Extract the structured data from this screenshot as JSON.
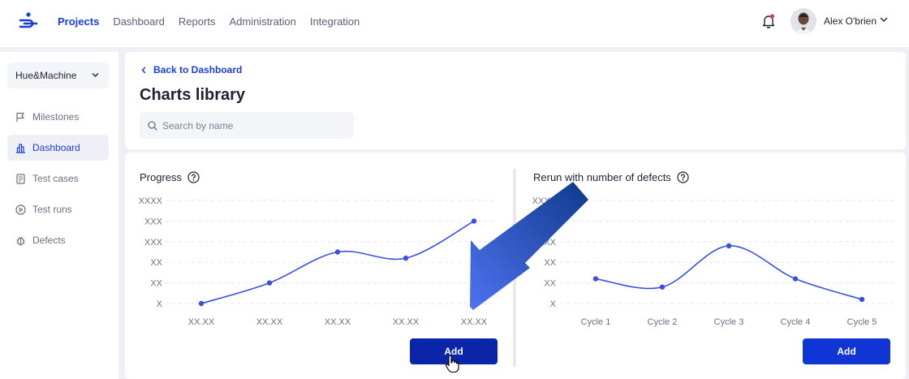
{
  "nav": {
    "items": [
      "Projects",
      "Dashboard",
      "Reports",
      "Administration",
      "Integration"
    ],
    "active_index": 0
  },
  "user": {
    "name": "Alex O'brien"
  },
  "sidebar": {
    "project": "Hue&Machine",
    "items": [
      {
        "label": "Milestones",
        "icon": "flag-icon"
      },
      {
        "label": "Dashboard",
        "icon": "bar-chart-icon",
        "active": true
      },
      {
        "label": "Test cases",
        "icon": "document-icon"
      },
      {
        "label": "Test runs",
        "icon": "play-circle-icon"
      },
      {
        "label": "Defects",
        "icon": "bug-icon"
      }
    ]
  },
  "header": {
    "back_label": "Back to Dashboard",
    "title": "Charts library",
    "search_placeholder": "Search by name"
  },
  "charts": [
    {
      "title": "Progress",
      "add_label": "Add"
    },
    {
      "title": "Rerun with number of defects",
      "add_label": "Add"
    }
  ],
  "chart_data": [
    {
      "type": "line",
      "title": "Progress",
      "categories": [
        "XX.XX",
        "XX.XX",
        "XX.XX",
        "XX.XX",
        "XX.XX"
      ],
      "y_tick_labels": [
        "X",
        "XX",
        "XX",
        "XXX",
        "XXX",
        "XXXX"
      ],
      "values": [
        0,
        1,
        2.5,
        2.2,
        4
      ],
      "ylim": [
        0,
        5
      ],
      "grid": true,
      "color": "#3a51e0"
    },
    {
      "type": "line",
      "title": "Rerun with number of defects",
      "categories": [
        "Cycle 1",
        "Cycle 2",
        "Cycle 3",
        "Cycle 4",
        "Cycle 5"
      ],
      "y_tick_labels": [
        "X",
        "XX",
        "XX",
        "XXX",
        "XXX",
        "XXXX"
      ],
      "values": [
        1.2,
        0.8,
        2.8,
        1.2,
        0.2
      ],
      "ylim": [
        0,
        5
      ],
      "grid": true,
      "color": "#3a51e0"
    }
  ],
  "colors": {
    "accent": "#0f36d4",
    "arrow": "#2f5be0"
  }
}
